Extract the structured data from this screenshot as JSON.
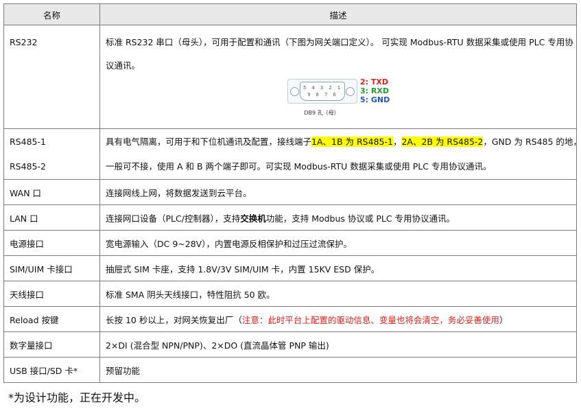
{
  "header": {
    "name": "名称",
    "desc": "描述"
  },
  "rows": {
    "rs232": {
      "name": "RS232",
      "line1": "标准 RS232 串口（母头），可用于配置和通讯（下图为网关端口定义）。 可实现 Modbus-RTU 数据采集或使用 PLC 专用协",
      "line2": "议通讯。",
      "diagram": {
        "pins_top": "5 4 3 2 1",
        "pins_bottom": "9 8 7 6",
        "caption": "DB9 孔（母）",
        "labels": [
          {
            "text": "2:  TXD",
            "color": "#e0201b"
          },
          {
            "text": "3:  RXD",
            "color": "#1f9e2e"
          },
          {
            "text": "5:  GND",
            "color": "#1a56c8"
          }
        ]
      }
    },
    "rs485": {
      "name1": "RS485-1",
      "name2": "RS485-2",
      "l1_a": "具有电气隔离，可用于和下位机通讯及配置，接线端子",
      "l1_hl1": "1A、1B 为 RS485-1",
      "l1_sep": "，",
      "l1_hl2": "2A、2B 为 RS485-2",
      "l1_b": "，GND 为 RS485 的地，",
      "line2": "一般可不接，使用 A 和 B 两个端子即可。可实现 Modbus-RTU 数据采集或使用 PLC 专用协议通讯。"
    },
    "wan": {
      "name": "WAN 口",
      "desc": "连接网线上网，将数据发送到云平台。"
    },
    "lan": {
      "name": "LAN 口",
      "desc_a": "连接网口设备（PLC/控制器），支持",
      "desc_bold": "交换机",
      "desc_b": "功能，支持 Modbus 协议或 PLC 专用协议通讯。"
    },
    "power": {
      "name": "电源接口",
      "desc": "宽电源输入（DC 9~28V），内置电源反相保护和过压过流保护。"
    },
    "sim": {
      "name": "SIM/UIM 卡接口",
      "desc": "抽屉式 SIM 卡座，支持 1.8V/3V SIM/UIM 卡，内置 15KV ESD 保护。"
    },
    "antenna": {
      "name": "天线接口",
      "desc": "标准 SMA 阴头天线接口，特性阻抗 50 欧。"
    },
    "reload": {
      "name": "Reload 按键",
      "desc_a": "长按 10 秒以上，对网关恢复出厂（",
      "desc_warn": "注意：此时平台上配置的驱动信息、变量也将会清空，务必妥善使用",
      "desc_b": "）"
    },
    "digital": {
      "name": "数字量接口",
      "desc": "2×DI (混合型 NPN/PNP)、2×DO (直流晶体管 PNP 输出)"
    },
    "usb": {
      "name": "USB 接口/SD 卡*",
      "desc": "预留功能"
    }
  },
  "footnote": "*为设计功能，正在开发中。"
}
